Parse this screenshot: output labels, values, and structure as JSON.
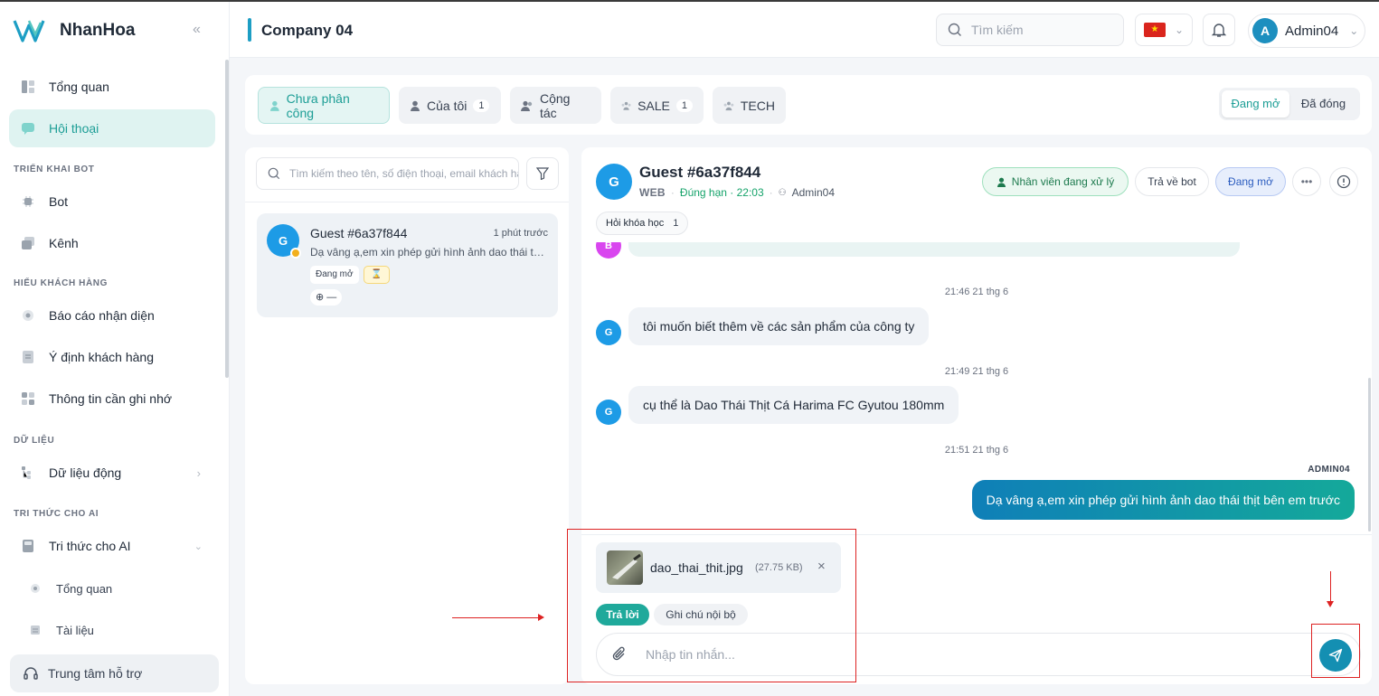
{
  "brand": {
    "name": "NhanHoa"
  },
  "sidebar": {
    "items": [
      {
        "label": "Tổng quan"
      },
      {
        "label": "Hội thoại"
      }
    ],
    "sections": {
      "bot": "TRIỂN KHAI BOT",
      "customer": "HIỂU KHÁCH HÀNG",
      "data": "DỮ LIỆU",
      "ai": "TRI THỨC CHO AI"
    },
    "bot_items": [
      {
        "label": "Bot"
      },
      {
        "label": "Kênh"
      }
    ],
    "customer_items": [
      {
        "label": "Báo cáo nhận diện"
      },
      {
        "label": "Ý định khách hàng"
      },
      {
        "label": "Thông tin cần ghi nhớ"
      }
    ],
    "data_items": [
      {
        "label": "Dữ liệu động"
      }
    ],
    "ai_items": [
      {
        "label": "Tri thức cho AI"
      }
    ],
    "ai_sub": [
      {
        "label": "Tổng quan"
      },
      {
        "label": "Tài liệu"
      }
    ],
    "help": "Trung tâm hỗ trợ"
  },
  "header": {
    "title": "Company 04",
    "search_placeholder": "Tìm kiếm",
    "user": "Admin04",
    "user_initial": "A"
  },
  "tabs": [
    {
      "label": "Chưa phân công"
    },
    {
      "label": "Của tôi",
      "count": "1"
    },
    {
      "label": "Cộng tác"
    },
    {
      "label": "SALE",
      "count": "1"
    },
    {
      "label": "TECH"
    }
  ],
  "status_toggle": {
    "open": "Đang mở",
    "closed": "Đã đóng"
  },
  "list": {
    "search_placeholder": "Tìm kiếm theo tên, số điện thoại, email khách hàng",
    "conversation": {
      "initial": "G",
      "name": "Guest #6a37f844",
      "time": "1 phút trước",
      "preview": "Dạ vâng ạ,em xin phép gửi hình ảnh dao thái thịt bên em trước",
      "status": "Đang mở",
      "hourglass": "⌛",
      "channel": "⊕ —"
    }
  },
  "chat": {
    "initial": "G",
    "name": "Guest #6a37f844",
    "channel": "WEB",
    "sla": "Đúng hạn · 22:03",
    "agent": "Admin04",
    "btn_agent": "Nhân viên đang xử lý",
    "btn_return": "Trả về bot",
    "btn_status": "Đang mở",
    "tag": {
      "label": "Hỏi khóa học",
      "count": "1"
    },
    "messages": [
      {
        "type": "ts",
        "text": "21:46 21 thg 6"
      },
      {
        "type": "in",
        "text": "tôi muốn biết thêm về các sản phẩm của công ty"
      },
      {
        "type": "ts",
        "text": "21:49 21 thg 6"
      },
      {
        "type": "in",
        "text": "cụ thể là Dao Thái Thịt Cá Harima FC Gyutou 180mm"
      },
      {
        "type": "ts",
        "text": "21:51 21 thg 6"
      },
      {
        "type": "owner",
        "text": "ADMIN04"
      },
      {
        "type": "out",
        "text": "Dạ vâng ạ,em xin phép gửi hình ảnh dao thái thịt bên em trước"
      }
    ],
    "attachment": {
      "name": "dao_thai_thit.jpg",
      "size": "(27.75 KB)"
    },
    "mode_reply": "Trả lời",
    "mode_note": "Ghi chú nội bộ",
    "input_placeholder": "Nhập tin nhắn..."
  },
  "colors": {
    "accent": "#1d9e96",
    "avatar": "#1d9be6",
    "send": "#148fb2",
    "annotation": "#dd2222"
  }
}
